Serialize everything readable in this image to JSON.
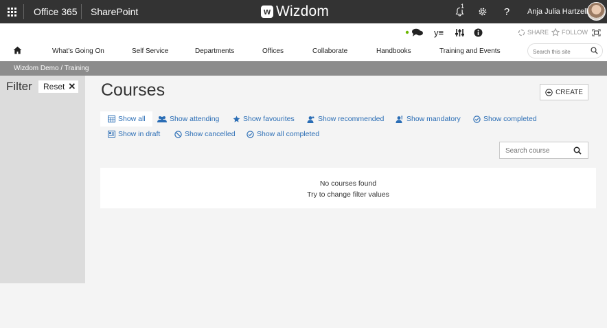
{
  "o365": {
    "app_launcher": "Office 365",
    "app_name": "SharePoint",
    "brand": "Wizdom",
    "notification_count": "1",
    "user_name": "Anja Julia Hartzell"
  },
  "suite_tools": {
    "share_label": "SHARE",
    "follow_label": "FOLLOW",
    "presence_color": "#6bb700"
  },
  "topnav": {
    "items": [
      {
        "label": "What's Going On"
      },
      {
        "label": "Self Service"
      },
      {
        "label": "Departments"
      },
      {
        "label": "Offices"
      },
      {
        "label": "Collaborate"
      },
      {
        "label": "Handbooks"
      },
      {
        "label": "Training and Events"
      }
    ],
    "search_placeholder": "Search this site"
  },
  "breadcrumb": "Wizdom Demo / Training",
  "filter": {
    "title": "Filter",
    "reset_label": "Reset"
  },
  "page": {
    "title": "Courses",
    "create_label": "CREATE"
  },
  "filters": [
    {
      "label": "Show all",
      "icon": "calendar-icon",
      "active": true
    },
    {
      "label": "Show attending",
      "icon": "people-icon"
    },
    {
      "label": "Show favourites",
      "icon": "star-icon"
    },
    {
      "label": "Show recommended",
      "icon": "person-recommend-icon"
    },
    {
      "label": "Show mandatory",
      "icon": "person-mandatory-icon"
    },
    {
      "label": "Show completed",
      "icon": "check-circle-icon"
    },
    {
      "label": "Show in draft",
      "icon": "draft-icon"
    },
    {
      "label": "Show cancelled",
      "icon": "cancel-icon"
    },
    {
      "label": "Show all completed",
      "icon": "check-circle-icon"
    }
  ],
  "search": {
    "placeholder": "Search course"
  },
  "results": {
    "empty_title": "No courses found",
    "empty_hint": "Try to change filter values"
  },
  "colors": {
    "suite_bar": "#333333",
    "link_blue": "#2a6db5",
    "breadcrumb_bar": "#8c8c8c",
    "filter_pane": "#dcdcdc",
    "page_bg": "#f4f4f4"
  }
}
